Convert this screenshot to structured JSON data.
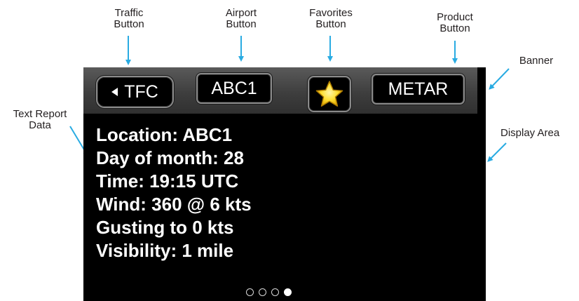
{
  "callouts": {
    "traffic": [
      "Traffic",
      "Button"
    ],
    "airport": [
      "Airport",
      "Button"
    ],
    "favorites": [
      "Favorites",
      "Button"
    ],
    "product": [
      "Product",
      "Button"
    ],
    "banner": "Banner",
    "text_report": [
      "Text Report",
      "Data"
    ],
    "display_area": "Display Area"
  },
  "banner": {
    "traffic_button_label": "TFC",
    "airport_button_label": "ABC1",
    "favorites_icon": "star-icon",
    "product_button_label": "METAR"
  },
  "report": {
    "lines": [
      "Location: ABC1",
      "Day of month: 28",
      "Time: 19:15 UTC",
      "Wind: 360 @ 6 kts",
      "Gusting to 0 kts",
      "Visibility: 1 mile"
    ]
  },
  "pager": {
    "page_count": 4,
    "active_page": 4
  },
  "colors": {
    "arrow": "#29abe2",
    "screen_background": "#000000",
    "banner_background": "#4a4a4a",
    "star_fill": "#ffe033",
    "text": "#ffffff"
  }
}
